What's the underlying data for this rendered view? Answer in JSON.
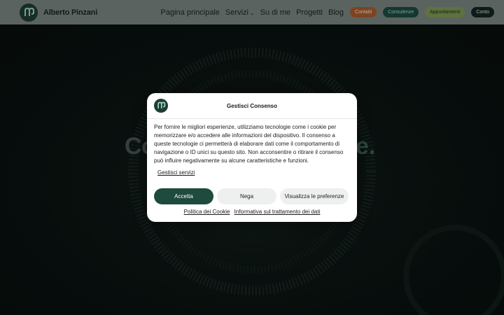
{
  "header": {
    "brand": "Alberto Pinzani",
    "nav": {
      "home": "Pagina principale",
      "services": "Servizi",
      "about": "Su di me",
      "projects": "Progetti",
      "blog": "Blog"
    },
    "pills": {
      "contacts": "Contatti",
      "consulting": "Consulenze",
      "appointments": "Appuntamenti",
      "account": "Conto"
    }
  },
  "hero": {
    "title_left": "Co",
    "title_right": "e."
  },
  "consent": {
    "title": "Gestisci Consenso",
    "body": "Per fornire le migliori esperienze, utilizziamo tecnologie come i cookie per memorizzare e/o accedere alle informazioni del dispositivo. Il consenso a queste tecnologie ci permetterà di elaborare dati come il comportamento di navigazione o ID unici su questo sito. Non acconsentire o ritirare il consenso può influire negativamente su alcune caratteristiche e funzioni.",
    "manage_services": "Gestisci servizi",
    "accept": "Accetta",
    "deny": "Nega",
    "preferences": "Visualizza le preferenze",
    "cookie_policy": "Politica dei Cookie",
    "privacy_policy": "Informativa sul trattamento dei dati"
  },
  "colors": {
    "brand_dark": "#1f4a3e",
    "contacts_pill": "#a85b2c",
    "consulting_pill": "#1d4a42",
    "appointments_pill": "#7c9a54",
    "account_pill": "#132520"
  }
}
